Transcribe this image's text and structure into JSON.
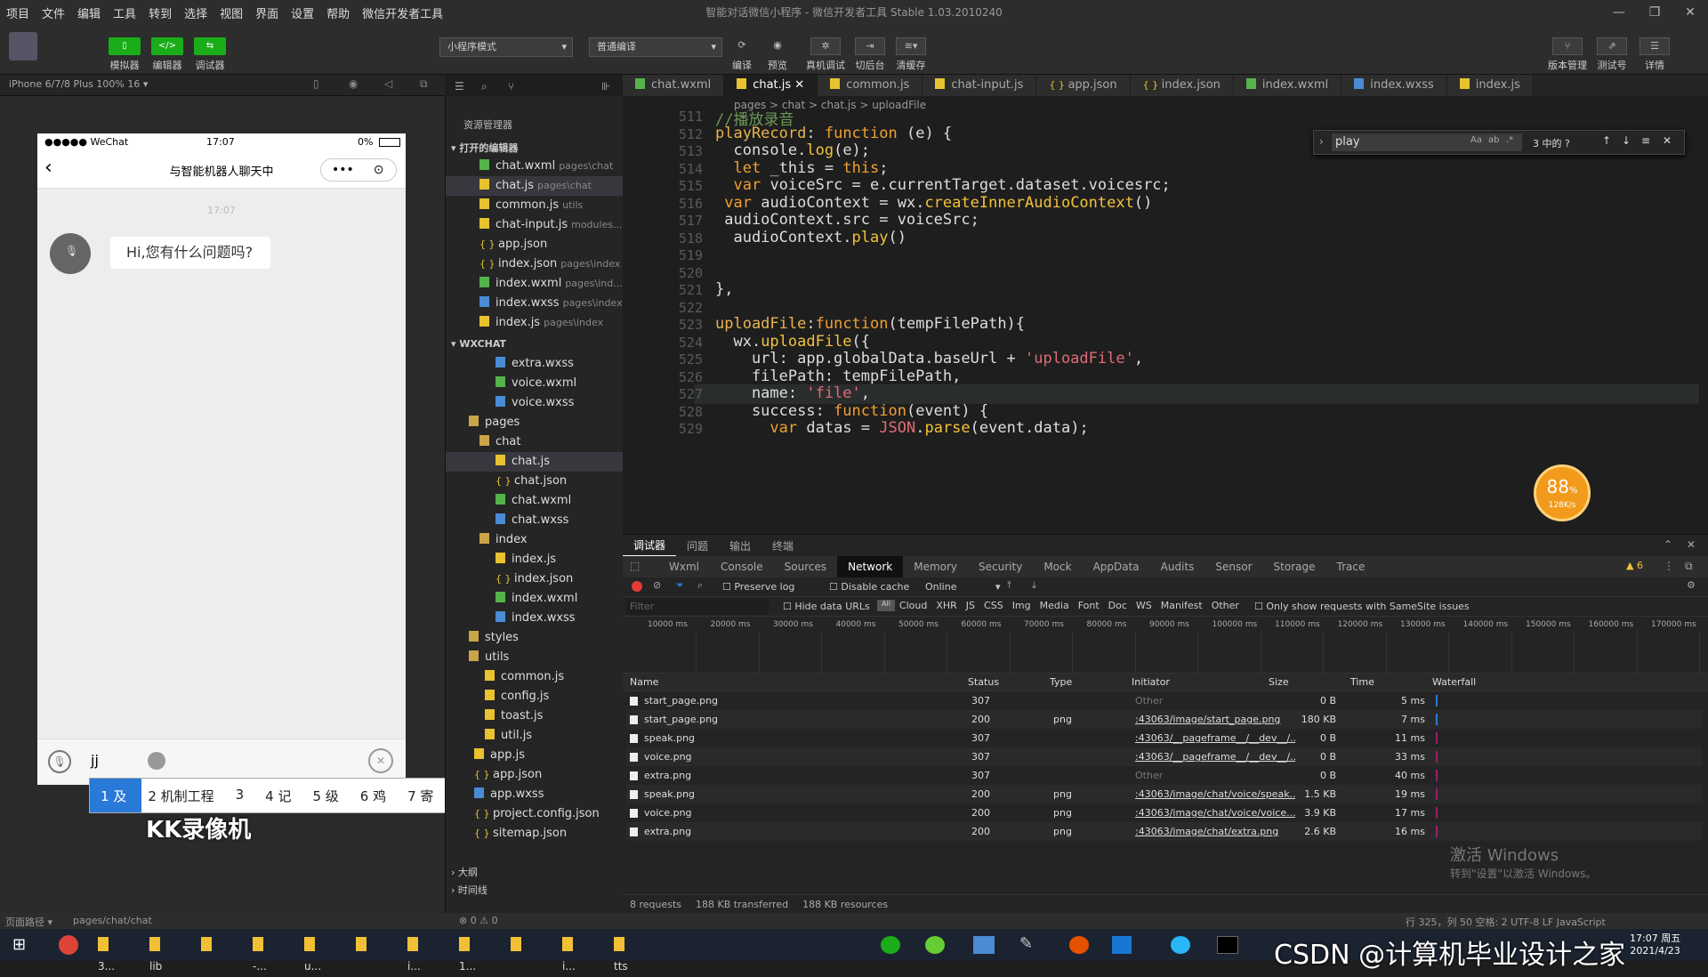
{
  "menubar": [
    "项目",
    "文件",
    "编辑",
    "工具",
    "转到",
    "选择",
    "视图",
    "界面",
    "设置",
    "帮助",
    "微信开发者工具"
  ],
  "window": {
    "title": "智能对话微信小程序 - 微信开发者工具 Stable 1.03.2010240"
  },
  "toolbar": {
    "simulator": "模拟器",
    "editor": "编辑器",
    "debugger": "调试器",
    "mode": "小程序模式",
    "compile": "普通编译",
    "compile_btn": "编译",
    "preview": "预览",
    "realdebug": "真机调试",
    "background": "切后台",
    "clearcache": "清缓存",
    "version": "版本管理",
    "testno": "测试号",
    "detail": "详情"
  },
  "sim": {
    "device": "iPhone 6/7/8 Plus 100% 16 ▾"
  },
  "phone": {
    "carrier": "●●●●● WeChat",
    "time": "17:07",
    "battery": "0%",
    "title": "与智能机器人聊天中",
    "msg_time": "17:07",
    "bubble": "Hi,您有什么问题吗?",
    "input": "jj"
  },
  "ime": {
    "candidates": [
      "1 及",
      "2 机制工程",
      "3 ",
      "4 记",
      "5 级",
      "6 鸡",
      "7 寄"
    ],
    "watermark": "KK录像机"
  },
  "explorer": {
    "title": "资源管理器",
    "open_editors": "打开的编辑器",
    "project": "WXCHAT",
    "outline": "大纲",
    "timeline": "时间线",
    "open": [
      {
        "name": "chat.wxml",
        "hint": "pages\\chat",
        "t": "wx"
      },
      {
        "name": "chat.js",
        "hint": "pages\\chat",
        "t": "js"
      },
      {
        "name": "common.js",
        "hint": "utils",
        "t": "js"
      },
      {
        "name": "chat-input.js",
        "hint": "modules...",
        "t": "js"
      },
      {
        "name": "app.json",
        "hint": "",
        "t": "jn"
      },
      {
        "name": "index.json",
        "hint": "pages\\index",
        "t": "jn"
      },
      {
        "name": "index.wxml",
        "hint": "pages\\ind...",
        "t": "wx"
      },
      {
        "name": "index.wxss",
        "hint": "pages\\index",
        "t": "ws"
      },
      {
        "name": "index.js",
        "hint": "pages\\index",
        "t": "js"
      }
    ],
    "tree": [
      {
        "name": "extra.wxss",
        "t": "ws",
        "d": 3
      },
      {
        "name": "voice.wxml",
        "t": "wx",
        "d": 3
      },
      {
        "name": "voice.wxss",
        "t": "ws",
        "d": 3
      },
      {
        "name": "pages",
        "t": "fold",
        "d": 1
      },
      {
        "name": "chat",
        "t": "fold",
        "d": 2
      },
      {
        "name": "chat.js",
        "t": "js",
        "d": 3
      },
      {
        "name": "chat.json",
        "t": "jn",
        "d": 3
      },
      {
        "name": "chat.wxml",
        "t": "wx",
        "d": 3
      },
      {
        "name": "chat.wxss",
        "t": "ws",
        "d": 3
      },
      {
        "name": "index",
        "t": "fold",
        "d": 2
      },
      {
        "name": "index.js",
        "t": "js",
        "d": 3
      },
      {
        "name": "index.json",
        "t": "jn",
        "d": 3
      },
      {
        "name": "index.wxml",
        "t": "wx",
        "d": 3
      },
      {
        "name": "index.wxss",
        "t": "ws",
        "d": 3
      },
      {
        "name": "styles",
        "t": "fold",
        "d": 1
      },
      {
        "name": "utils",
        "t": "fold",
        "d": 1
      },
      {
        "name": "common.js",
        "t": "js",
        "d": 2
      },
      {
        "name": "config.js",
        "t": "js",
        "d": 2
      },
      {
        "name": "toast.js",
        "t": "js",
        "d": 2
      },
      {
        "name": "util.js",
        "t": "js",
        "d": 2
      },
      {
        "name": "app.js",
        "t": "js",
        "d": 1
      },
      {
        "name": "app.json",
        "t": "jn",
        "d": 1
      },
      {
        "name": "app.wxss",
        "t": "ws",
        "d": 1
      },
      {
        "name": "project.config.json",
        "t": "jn",
        "d": 1
      },
      {
        "name": "sitemap.json",
        "t": "jn",
        "d": 1
      }
    ]
  },
  "tabs": [
    "chat.wxml",
    "chat.js",
    "common.js",
    "chat-input.js",
    "app.json",
    "index.json",
    "index.wxml",
    "index.wxss",
    "index.js"
  ],
  "breadcrumb": "pages > chat > chat.js > uploadFile",
  "find": {
    "query": "play",
    "result": "3 中的 ?"
  },
  "code": [
    {
      "n": "511",
      "html": "<span style='color:#6a9955'>//播放录音</span>"
    },
    {
      "n": "512",
      "html": "<span class='ca'>playRecord</span>: <span class='k'>function</span> (e) {"
    },
    {
      "n": "513",
      "html": "  console.<span class='f'>log</span>(e);"
    },
    {
      "n": "514",
      "html": "  <span class='k'>let</span> _this = <span class='k'>this</span>;"
    },
    {
      "n": "515",
      "html": "  <span class='k'>var</span> voiceSrc = e.currentTarget.dataset.voicesrc;"
    },
    {
      "n": "516",
      "html": " <span class='k'>var</span> audioContext = wx.<span class='f'>createInnerAudioContext</span>()"
    },
    {
      "n": "517",
      "html": " audioContext.src = voiceSrc;"
    },
    {
      "n": "518",
      "html": "  audioContext.<span class='f'>play</span>()"
    },
    {
      "n": "519",
      "html": ""
    },
    {
      "n": "520",
      "html": ""
    },
    {
      "n": "521",
      "html": "},"
    },
    {
      "n": "522",
      "html": ""
    },
    {
      "n": "523",
      "html": "<span class='ca'>uploadFile</span>:<span class='k'>function</span>(tempFilePath){"
    },
    {
      "n": "524",
      "html": "  wx.<span class='f'>uploadFile</span>({"
    },
    {
      "n": "525",
      "html": "    url: app.globalData.baseUrl + <span class='s'>'uploadFile'</span>,"
    },
    {
      "n": "526",
      "html": "    filePath: tempFilePath,"
    },
    {
      "n": "527",
      "html": "    name: <span class='s'>'file'</span>,"
    },
    {
      "n": "528",
      "html": "    success: <span class='k'>function</span>(event) {"
    },
    {
      "n": "529",
      "html": "      <span class='k'>var</span> datas = <span class='s'>JSON</span>.<span class='f'>parse</span>(event.data);"
    }
  ],
  "perf": {
    "pct": "88",
    "unit": "%",
    "speed": "128K/s"
  },
  "devtools": {
    "top": [
      "调试器",
      "问题",
      "输出",
      "终端"
    ],
    "tabs": [
      "Wxml",
      "Console",
      "Sources",
      "Network",
      "Memory",
      "Security",
      "Mock",
      "AppData",
      "Audits",
      "Sensor",
      "Storage",
      "Trace"
    ],
    "warn": "6",
    "preserve": "Preserve log",
    "disable": "Disable cache",
    "online": "Online",
    "filter": "Filter",
    "hide": "Hide data URLs",
    "types": [
      "All",
      "Cloud",
      "XHR",
      "JS",
      "CSS",
      "Img",
      "Media",
      "Font",
      "Doc",
      "WS",
      "Manifest",
      "Other"
    ],
    "samesite": "Only show requests with SameSite issues",
    "ticks": [
      "10000 ms",
      "20000 ms",
      "30000 ms",
      "40000 ms",
      "50000 ms",
      "60000 ms",
      "70000 ms",
      "80000 ms",
      "90000 ms",
      "100000 ms",
      "110000 ms",
      "120000 ms",
      "130000 ms",
      "140000 ms",
      "150000 ms",
      "160000 ms",
      "170000 ms"
    ],
    "cols": [
      "Name",
      "Status",
      "Type",
      "Initiator",
      "Size",
      "Time",
      "Waterfall"
    ],
    "rows": [
      {
        "name": "start_page.png",
        "status": "307",
        "type": "",
        "init": "Other",
        "size": "0 B",
        "time": "5 ms"
      },
      {
        "name": "start_page.png",
        "status": "200",
        "type": "png",
        "init": ":43063/image/start_page.png",
        "size": "180 KB",
        "time": "7 ms"
      },
      {
        "name": "speak.png",
        "status": "307",
        "type": "",
        "init": ":43063/__pageframe__/__dev__/...",
        "size": "0 B",
        "time": "11 ms"
      },
      {
        "name": "voice.png",
        "status": "307",
        "type": "",
        "init": ":43063/__pageframe__/__dev__/...",
        "size": "0 B",
        "time": "33 ms"
      },
      {
        "name": "extra.png",
        "status": "307",
        "type": "",
        "init": "Other",
        "size": "0 B",
        "time": "40 ms"
      },
      {
        "name": "speak.png",
        "status": "200",
        "type": "png",
        "init": ":43063/image/chat/voice/speak...",
        "size": "1.5 KB",
        "time": "19 ms"
      },
      {
        "name": "voice.png",
        "status": "200",
        "type": "png",
        "init": ":43063/image/chat/voice/voice...",
        "size": "3.9 KB",
        "time": "17 ms"
      },
      {
        "name": "extra.png",
        "status": "200",
        "type": "png",
        "init": ":43063/image/chat/extra.png",
        "size": "2.6 KB",
        "time": "16 ms"
      }
    ],
    "summary": [
      "8 requests",
      "188 KB transferred",
      "188 KB resources"
    ]
  },
  "activate": {
    "l1": "激活 Windows",
    "l2": "转到\"设置\"以激活 Windows。"
  },
  "status": {
    "path": "页面路径 ▾",
    "page": "pages/chat/chat",
    "errs": "⊗ 0 ⚠ 0",
    "right": "行 325，列 50  空格: 2  UTF-8  LF  JavaScript"
  },
  "taskbar": {
    "items": [
      "3...",
      "lib",
      "",
      "-...",
      "u...",
      "",
      "i...",
      "1...",
      "",
      "i...",
      "tts"
    ],
    "watermark": "CSDN @计算机毕业设计之家",
    "time": "17:07 周五",
    "date": "2021/4/23"
  }
}
